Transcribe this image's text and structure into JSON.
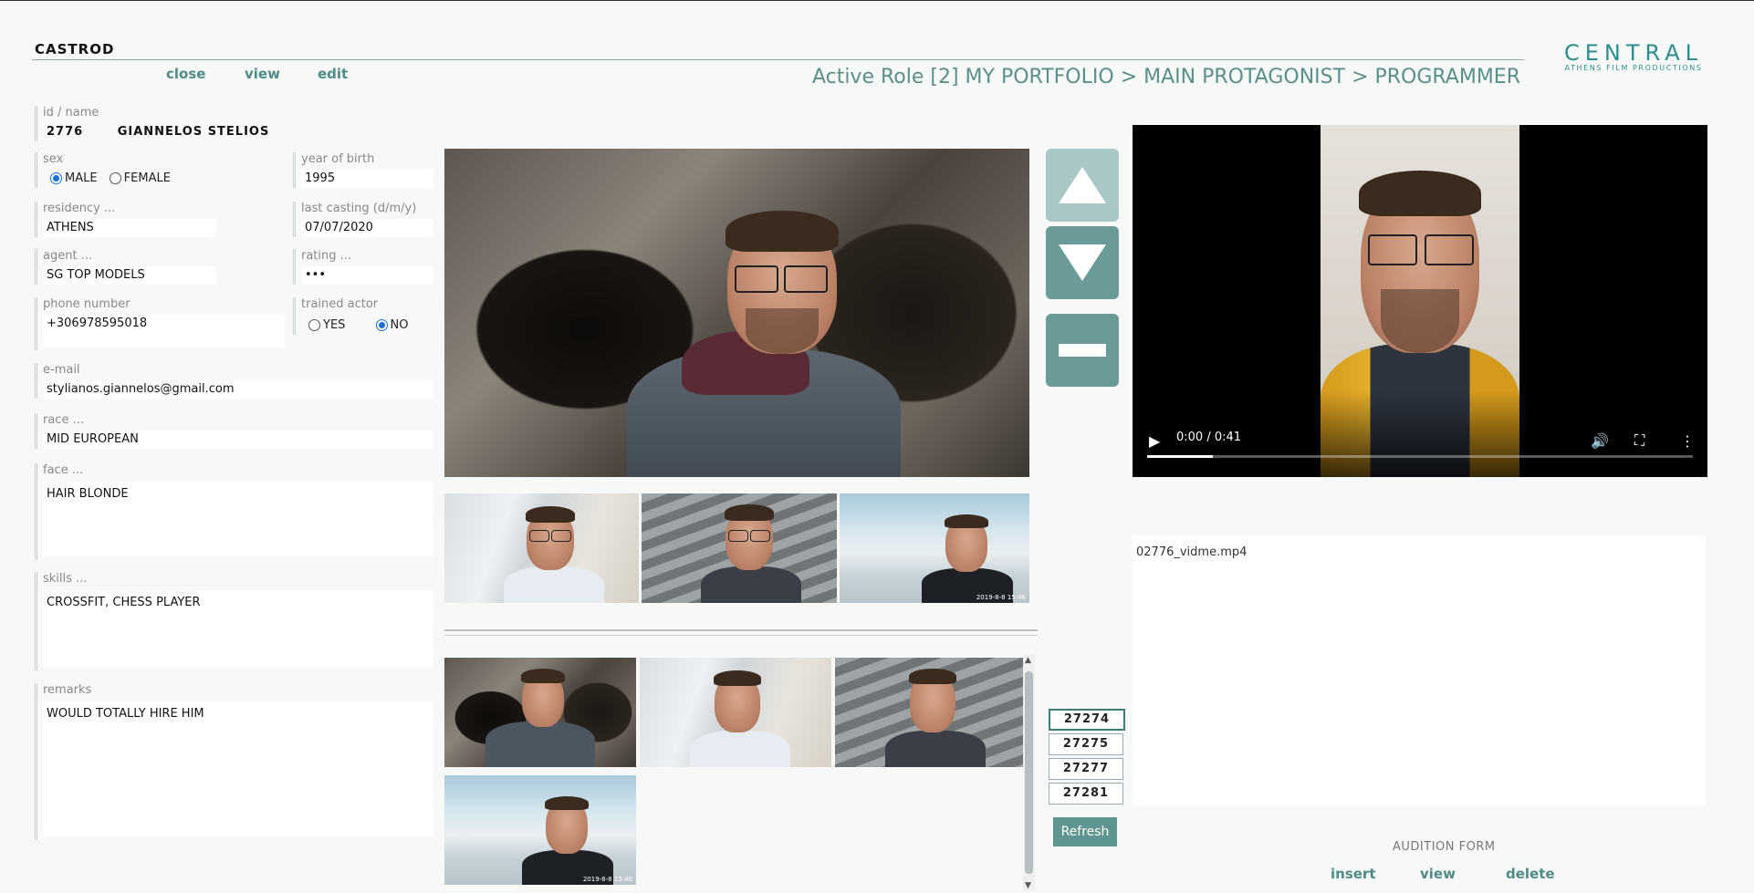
{
  "app": {
    "title": "CASTROD"
  },
  "nav": {
    "close": "close",
    "view": "view",
    "edit": "edit"
  },
  "breadcrumb": "Active Role [2] MY PORTFOLIO > MAIN PROTAGONIST > PROGRAMMER",
  "logo": {
    "line1": "CENTRAL",
    "line2": "ATHENS FILM PRODUCTIONS"
  },
  "form": {
    "id_name_label": "id / name",
    "id": "2776",
    "name": "GIANNELOS STELIOS",
    "sex_label": "sex",
    "sex_options": [
      "MALE",
      "FEMALE"
    ],
    "sex_selected": "MALE",
    "year_label": "year of birth",
    "year": "1995",
    "residency_label": "residency ...",
    "residency": "ATHENS",
    "last_casting_label": "last casting (d/m/y)",
    "last_casting": "07/07/2020",
    "agent_label": "agent ...",
    "agent": "SG TOP MODELS",
    "rating_label": "rating ...",
    "rating": "•••",
    "phone_label": "phone number",
    "phone": "+306978595018",
    "trained_label": "trained actor",
    "trained_options": [
      "YES",
      "NO"
    ],
    "trained_selected": "NO",
    "email_label": "e-mail",
    "email": "stylianos.giannelos@gmail.com",
    "race_label": "race ...",
    "race": "MID EUROPEAN",
    "face_label": "face ...",
    "face": "HAIR BLONDE",
    "skills_label": "skills ...",
    "skills": "CROSSFIT, CHESS PLAYER",
    "remarks_label": "remarks",
    "remarks": "WOULD TOTALLY HIRE HIM"
  },
  "photo_ids": [
    "27274",
    "27275",
    "27277",
    "27281"
  ],
  "photo_stamp": "2019-8-8 15:46",
  "refresh_label": "Refresh",
  "video": {
    "time": "0:00 / 0:41",
    "progress": 0.12,
    "filename": "02776_vidme.mp4"
  },
  "audition": {
    "title": "AUDITION FORM",
    "insert": "insert",
    "view": "view",
    "delete": "delete"
  },
  "colors": {
    "accent": "#4e8b86",
    "button": "#6a9b98",
    "button_light": "#a9c7c6"
  }
}
